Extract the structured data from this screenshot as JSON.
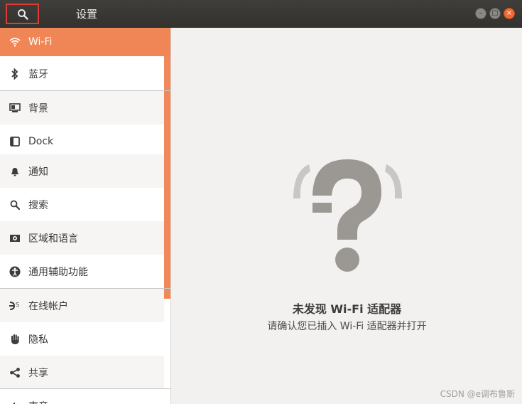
{
  "window": {
    "title": "设置",
    "buttons": {
      "minimize": "–",
      "maximize": "▢",
      "close": "×"
    }
  },
  "sidebar": {
    "items": [
      {
        "label": "Wi-Fi",
        "icon": "wifi-icon"
      },
      {
        "label": "蓝牙",
        "icon": "bluetooth-icon"
      },
      {
        "label": "背景",
        "icon": "background-icon"
      },
      {
        "label": "Dock",
        "icon": "dock-icon"
      },
      {
        "label": "通知",
        "icon": "bell-icon"
      },
      {
        "label": "搜索",
        "icon": "search-icon"
      },
      {
        "label": "区域和语言",
        "icon": "region-icon"
      },
      {
        "label": "通用辅助功能",
        "icon": "accessibility-icon"
      },
      {
        "label": "在线帐户",
        "icon": "online-accounts-icon"
      },
      {
        "label": "隐私",
        "icon": "privacy-hand-icon"
      },
      {
        "label": "共享",
        "icon": "share-icon"
      },
      {
        "label": "声音",
        "icon": "sound-icon"
      }
    ]
  },
  "main": {
    "empty_title": "未发现 Wi-Fi 适配器",
    "empty_subtitle": "请确认您已插入 Wi-Fi 适配器并打开"
  },
  "watermark": "CSDN @e调布鲁斯",
  "colors": {
    "accent": "#f08556",
    "titlebar": "#3a3936",
    "close": "#ef6a34"
  }
}
